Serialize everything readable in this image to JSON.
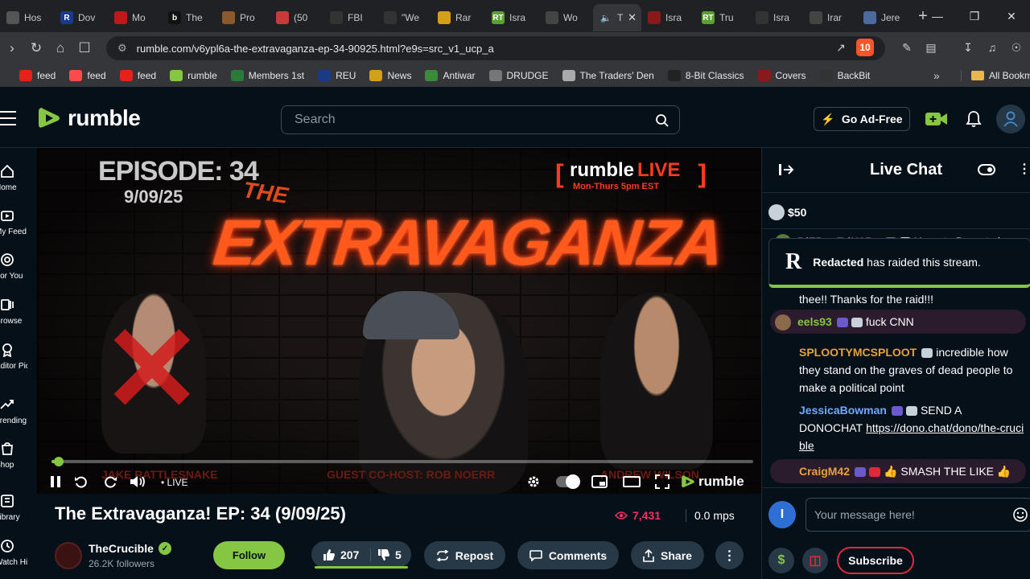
{
  "browser": {
    "tabs": [
      {
        "title": "Hos",
        "fav_color": "#555555",
        "fav_text": ""
      },
      {
        "title": "Dov",
        "fav_color": "#1a3a8a",
        "fav_text": "R"
      },
      {
        "title": "Mo",
        "fav_color": "#c0181a",
        "fav_text": ""
      },
      {
        "title": "The",
        "fav_color": "#111111",
        "fav_text": "b"
      },
      {
        "title": "Pro",
        "fav_color": "#8a5a2a",
        "fav_text": ""
      },
      {
        "title": "(50",
        "fav_color": "#c83a3a",
        "fav_text": ""
      },
      {
        "title": "FBI",
        "fav_color": "#333333",
        "fav_text": ""
      },
      {
        "title": "\"We",
        "fav_color": "#333333",
        "fav_text": ""
      },
      {
        "title": "Rar",
        "fav_color": "#d4a017",
        "fav_text": ""
      },
      {
        "title": "Isra",
        "fav_color": "#5aa032",
        "fav_text": "RT"
      },
      {
        "title": "Wo",
        "fav_color": "#444444",
        "fav_text": ""
      },
      {
        "title": "T",
        "fav_color": "#35363a",
        "fav_text": "",
        "active": true
      },
      {
        "title": "Isra",
        "fav_color": "#8a1a1a",
        "fav_text": ""
      },
      {
        "title": "Tru",
        "fav_color": "#5aa032",
        "fav_text": "RT"
      },
      {
        "title": "Isra",
        "fav_color": "#333333",
        "fav_text": ""
      },
      {
        "title": "Irar",
        "fav_color": "#444444",
        "fav_text": ""
      },
      {
        "title": "Jere",
        "fav_color": "#4a6aa0",
        "fav_text": ""
      }
    ],
    "url": "rumble.com/v6ypl6a-the-extravaganza-ep-34-90925.html?e9s=src_v1_ucp_a",
    "brave_count": "10",
    "bookmarks": [
      {
        "label": "feed",
        "color": "#e62117"
      },
      {
        "label": "feed",
        "color": "#ff4a4a"
      },
      {
        "label": "feed",
        "color": "#e62117"
      },
      {
        "label": "rumble",
        "color": "#85c742"
      },
      {
        "label": "Members 1st",
        "color": "#2a7a3a"
      },
      {
        "label": "REU",
        "color": "#1a3a8a"
      },
      {
        "label": "News",
        "color": "#d4a017"
      },
      {
        "label": "Antiwar",
        "color": "#3a8a3a"
      },
      {
        "label": "DRUDGE",
        "color": "#777777"
      },
      {
        "label": "The Traders' Den",
        "color": "#aaaaaa"
      },
      {
        "label": "8-Bit Classics",
        "color": "#222222"
      },
      {
        "label": "Covers",
        "color": "#8a1a1a"
      },
      {
        "label": "BackBit",
        "color": "#333333"
      }
    ],
    "all_bookmarks": "All Bookm"
  },
  "header": {
    "logo_text": "rumble",
    "search_placeholder": "Search",
    "go_ad_free": "Go Ad-Free"
  },
  "sidebar": {
    "items": [
      {
        "label": "Home",
        "icon": "home-icon"
      },
      {
        "label": "My Feed",
        "icon": "feed-icon"
      },
      {
        "label": "For You",
        "icon": "target-icon"
      },
      {
        "label": "Browse",
        "icon": "browse-icon"
      },
      {
        "label": "Editor Picks",
        "icon": "award-icon"
      },
      {
        "label": "Trending",
        "icon": "trending-icon"
      },
      {
        "label": "Shop",
        "icon": "shop-icon"
      },
      {
        "label": "Library",
        "icon": "library-icon"
      },
      {
        "label": "Watch History",
        "icon": "history-icon"
      }
    ]
  },
  "video": {
    "thumb_episode": "EPISODE: 34",
    "thumb_date": "9/09/25",
    "thumb_the": "THE",
    "thumb_title": "EXTRAVAGANZA",
    "thumb_rumble": "rumble",
    "thumb_live": "LIVE",
    "thumb_schedule": "Mon-Thurs 5pm EST",
    "thumb_name_left": "JAKE RATTLESNAKE",
    "thumb_name_center": "GUEST CO-HOST: ROB NOERR",
    "thumb_name_right": "ANDREW WILSON",
    "live_label": "LIVE",
    "progress_fraction": 0.01,
    "player_brand": "rumble",
    "title": "The Extravaganza! EP: 34 (9/09/25)",
    "views": "7,431",
    "mps": "0.0 mps"
  },
  "channel": {
    "name": "TheCrucible",
    "followers": "26.2K followers",
    "follow_label": "Follow"
  },
  "actions": {
    "likes": "207",
    "dislikes": "5",
    "repost": "Repost",
    "comments": "Comments",
    "share": "Share"
  },
  "chat": {
    "title": "Live Chat",
    "rant_amount": "$50",
    "raid_name": "Redacted",
    "raid_text": "has raided this stream.",
    "messages": [
      {
        "user": "DiZPosEdH3Ro",
        "text": "Humpty Dumpty is",
        "color": "#b56bff"
      },
      {
        "user": "",
        "text": "thee!! Thanks for the raid!!!",
        "color": "#ffffff"
      },
      {
        "user": "eels93",
        "text": "fuck CNN",
        "color": "#85c742"
      },
      {
        "user": "SPLOOTYMCSPLOOT",
        "text": "incredible how they stand on the graves of dead people to make a political point",
        "color": "#e6a23c"
      },
      {
        "user": "JessicaBowman",
        "text": "SEND A DONOCHAT",
        "link": "https://dono.chat/dono/the-crucible",
        "color": "#6fa8ff"
      },
      {
        "user": "CraigM42",
        "text": "👍 SMASH THE LIKE 👍",
        "color": "#e6a23c"
      }
    ],
    "input_placeholder": "Your message here!",
    "user_initial": "I",
    "subscribe": "Subscribe"
  }
}
